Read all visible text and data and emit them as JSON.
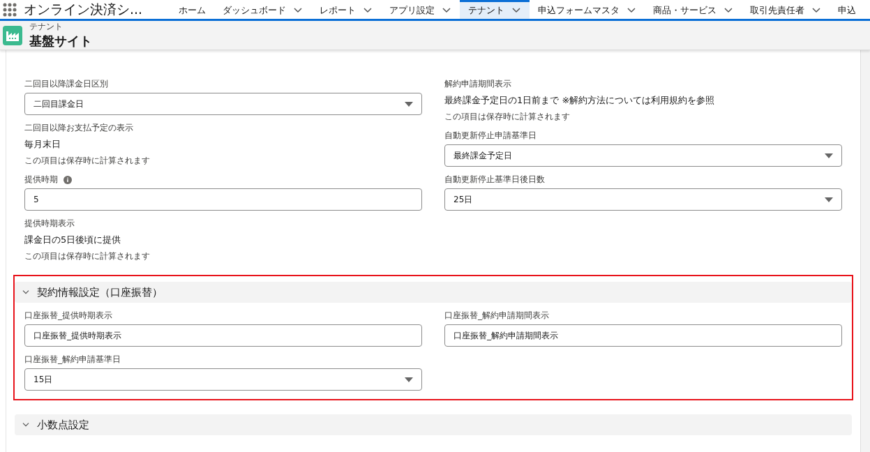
{
  "app_name": "オンライン決済シ...",
  "nav_tabs": [
    {
      "label": "ホーム",
      "has_menu": false,
      "selected": false
    },
    {
      "label": "ダッシュボード",
      "has_menu": true,
      "selected": false
    },
    {
      "label": "レポート",
      "has_menu": true,
      "selected": false
    },
    {
      "label": "アプリ設定",
      "has_menu": true,
      "selected": false
    },
    {
      "label": "テナント",
      "has_menu": true,
      "selected": true
    },
    {
      "label": "申込フォームマスタ",
      "has_menu": true,
      "selected": false
    },
    {
      "label": "商品・サービス",
      "has_menu": true,
      "selected": false
    },
    {
      "label": "取引先責任者",
      "has_menu": true,
      "selected": false
    },
    {
      "label": "申込",
      "has_menu": false,
      "selected": false
    }
  ],
  "record_header": {
    "object": "テナント",
    "title": "基盤サイト"
  },
  "fields": {
    "left": [
      {
        "kind": "select",
        "label": "二回目以降課金日区別",
        "value": "二回目課金日"
      },
      {
        "kind": "display",
        "label": "二回目以降お支払予定の表示",
        "value": "毎月末日",
        "note": "この項目は保存時に計算されます"
      },
      {
        "kind": "input",
        "label": "提供時期",
        "info": true,
        "value": "5"
      },
      {
        "kind": "display",
        "label": "提供時期表示",
        "value": "課金日の5日後頃に提供",
        "note": "この項目は保存時に計算されます"
      }
    ],
    "right": [
      {
        "kind": "display",
        "label": "解約申請期間表示",
        "value": "最終課金予定日の1日前まで ※解約方法については利用規約を参照",
        "note": "この項目は保存時に計算されます"
      },
      {
        "kind": "select",
        "label": "自動更新停止申請基準日",
        "value": "最終課金予定日"
      },
      {
        "kind": "select",
        "label": "自動更新停止基準日後日数",
        "value": "25日"
      }
    ]
  },
  "sections": [
    {
      "title": "契約情報設定（口座振替）",
      "expanded": true,
      "highlighted": true,
      "left": [
        {
          "kind": "input",
          "label": "口座振替_提供時期表示",
          "value": "口座振替_提供時期表示"
        },
        {
          "kind": "select",
          "label": "口座振替_解約申請基準日",
          "value": "15日"
        }
      ],
      "right": [
        {
          "kind": "input",
          "label": "口座振替_解約申請期間表示",
          "value": "口座振替_解約申請期間表示"
        }
      ]
    },
    {
      "title": "小数点設定",
      "expanded": true,
      "highlighted": false
    }
  ]
}
